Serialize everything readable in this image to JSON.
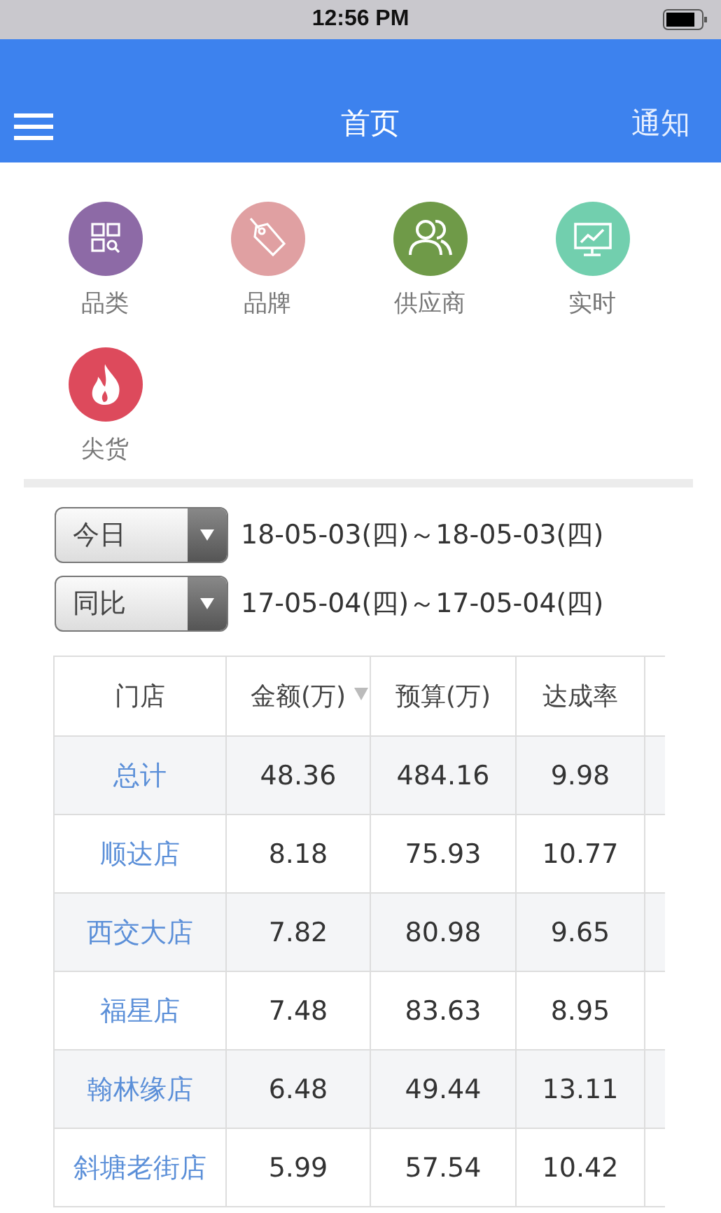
{
  "status_bar": {
    "time": "12:56 PM"
  },
  "nav_bar": {
    "title": "首页",
    "action": "通知"
  },
  "shortcuts": [
    {
      "label": "品类",
      "kind": "category",
      "color": "#8d6aa6"
    },
    {
      "label": "品牌",
      "kind": "brand",
      "color": "#e0a0a2"
    },
    {
      "label": "供应商",
      "kind": "supplier",
      "color": "#6f9a48"
    },
    {
      "label": "实时",
      "kind": "realtime",
      "color": "#72cfae"
    },
    {
      "label": "尖货",
      "kind": "hot",
      "color": "#dd4a5c"
    }
  ],
  "period_filters": [
    {
      "value": "今日",
      "range": "18-05-03(四)～18-05-03(四)"
    },
    {
      "value": "同比",
      "range": "17-05-04(四)～17-05-04(四)"
    }
  ],
  "table": {
    "columns": [
      {
        "label": "门店",
        "sorted": false
      },
      {
        "label": "金额(万)",
        "sorted": true
      },
      {
        "label": "预算(万)",
        "sorted": false
      },
      {
        "label": "达成率",
        "sorted": false
      }
    ],
    "rows": [
      [
        "总计",
        "48.36",
        "484.16",
        "9.98"
      ],
      [
        "顺达店",
        "8.18",
        "75.93",
        "10.77"
      ],
      [
        "西交大店",
        "7.82",
        "80.98",
        "9.65"
      ],
      [
        "福星店",
        "7.48",
        "83.63",
        "8.95"
      ],
      [
        "翰林缘店",
        "6.48",
        "49.44",
        "13.11"
      ],
      [
        "斜塘老街店",
        "5.99",
        "57.54",
        "10.42"
      ]
    ]
  }
}
